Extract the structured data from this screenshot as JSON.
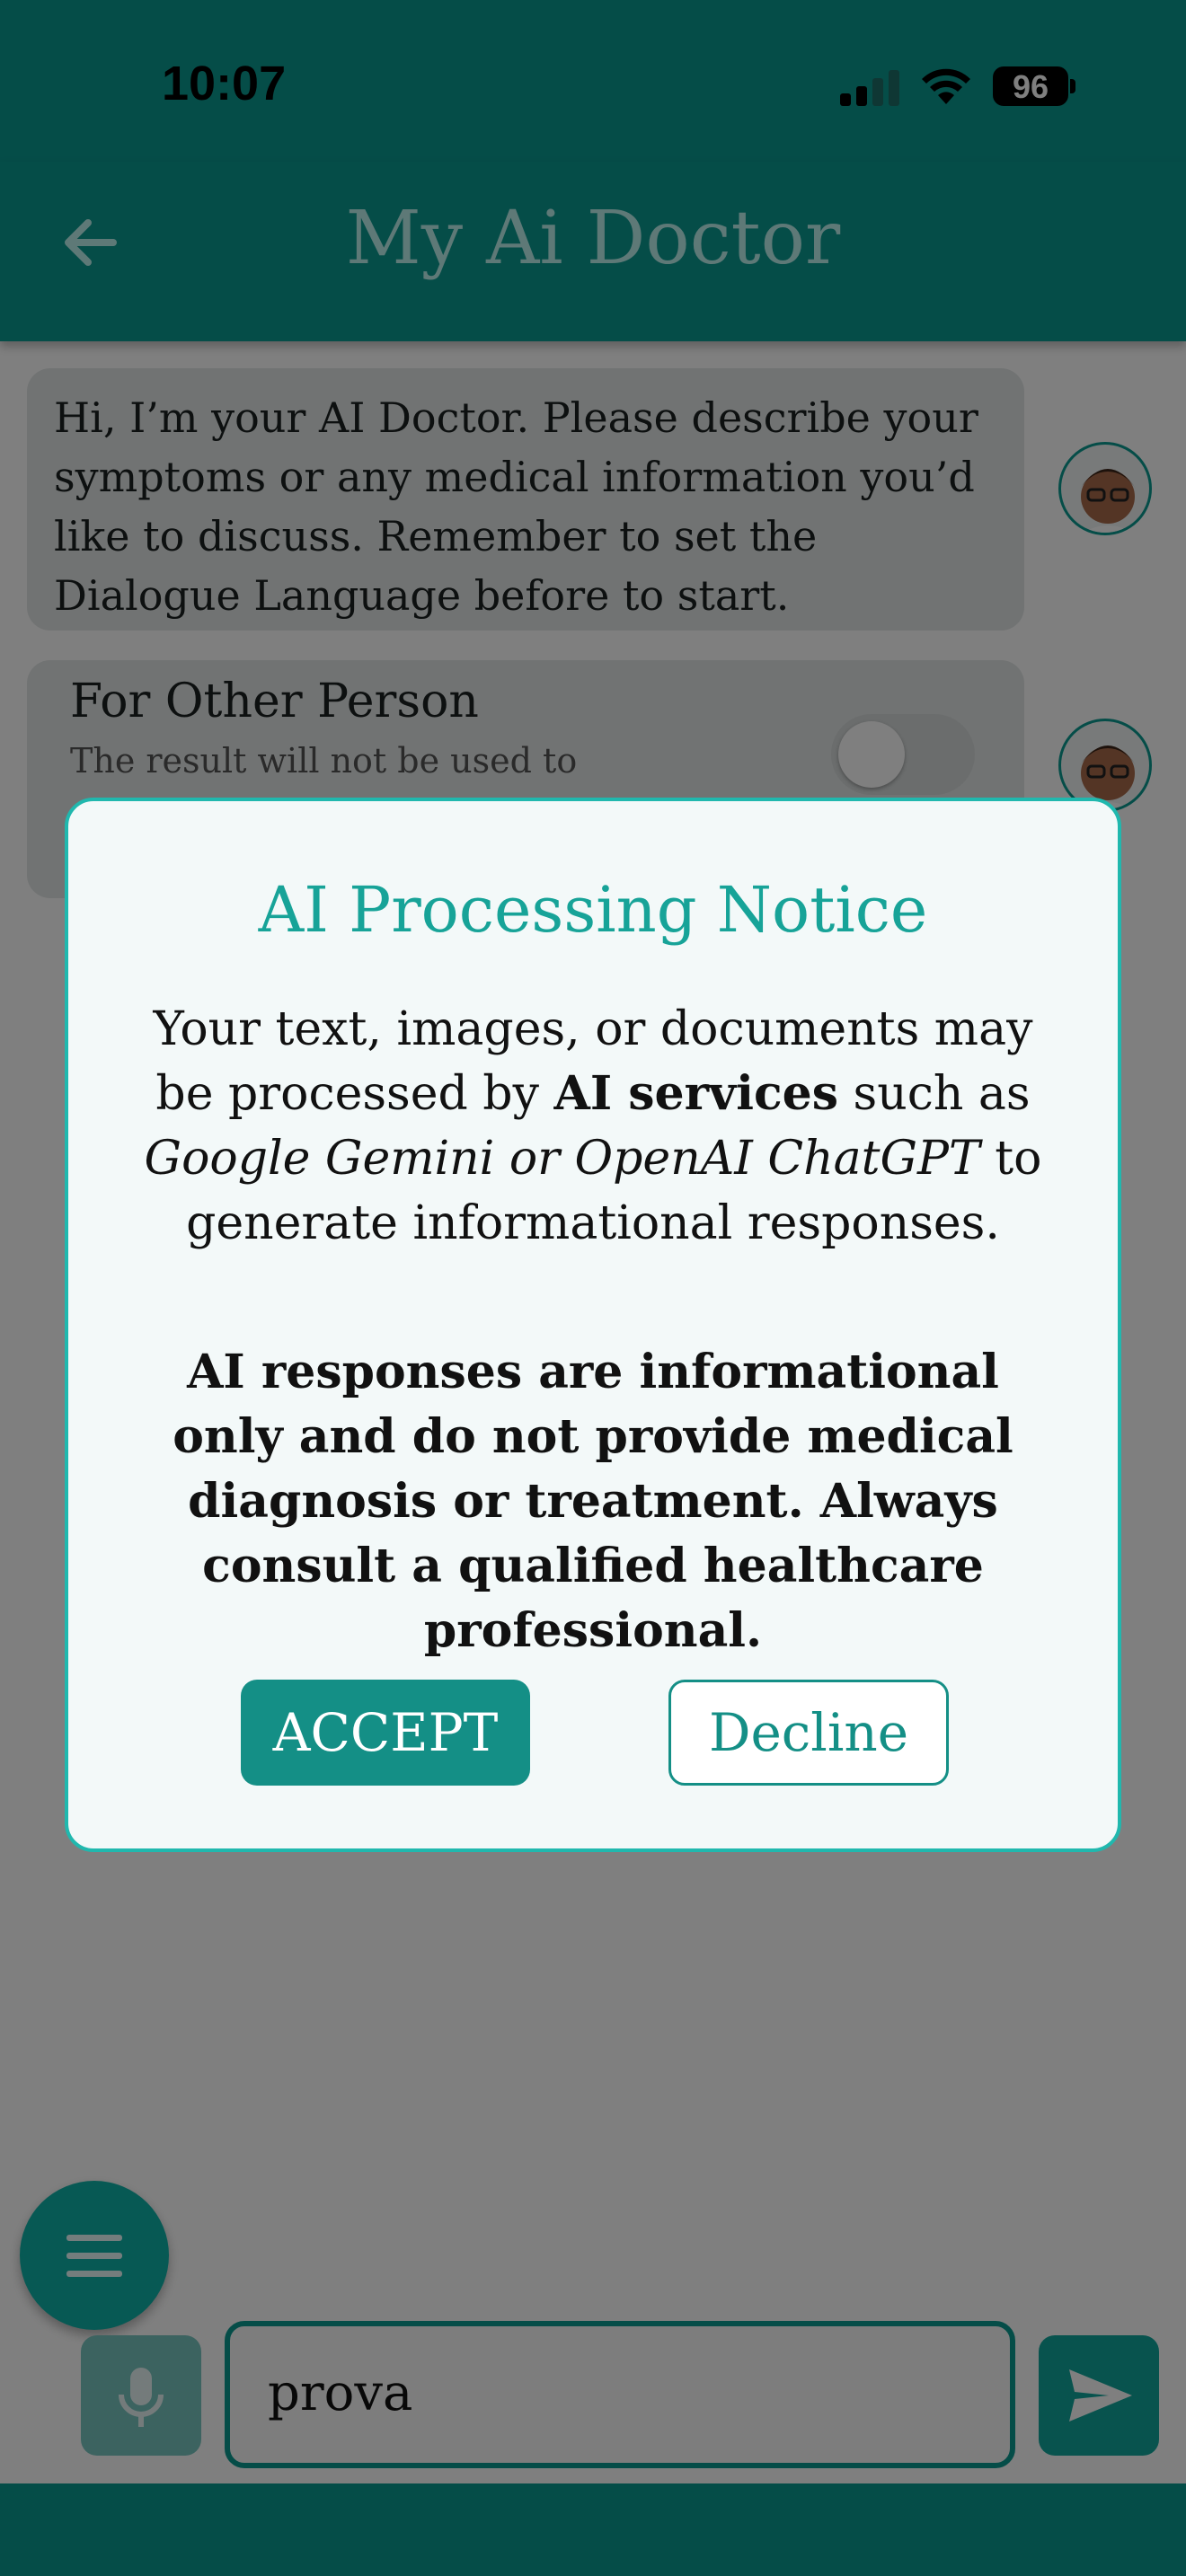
{
  "status_bar": {
    "time": "10:07",
    "battery": "96"
  },
  "app_bar": {
    "title": "My Ai Doctor",
    "back_icon": "arrow-left-icon"
  },
  "chat": {
    "welcome_message": "Hi, I’m your AI Doctor. Please describe your symptoms or any medical information you’d like to discuss. Remember to set the  Dialogue Language before to start.",
    "other_person_option": {
      "title": "For Other Person",
      "subtitle": "The result will not be used to",
      "toggle_on": false
    },
    "avatar_icon": "doctor-avatar-icon"
  },
  "dialog": {
    "title": "AI Processing Notice",
    "body": {
      "part1": "Your text, images, or documents may be processed by ",
      "bold": "AI services",
      "part2": " such as ",
      "italic": "Google Gemini or OpenAI ChatGPT",
      "part3": " to generate informational responses."
    },
    "warning": "AI responses are informational only and do not provide medical diagnosis or treatment. Always consult a qualified healthcare professional.",
    "accept_label": "ACCEPT",
    "decline_label": "Decline"
  },
  "composer": {
    "input_value": "prova",
    "mic_icon": "microphone-icon",
    "send_icon": "send-icon",
    "menu_icon": "menu-icon"
  },
  "colors": {
    "primary": "#0b9a91",
    "accent": "#17a398",
    "button": "#148f86"
  }
}
